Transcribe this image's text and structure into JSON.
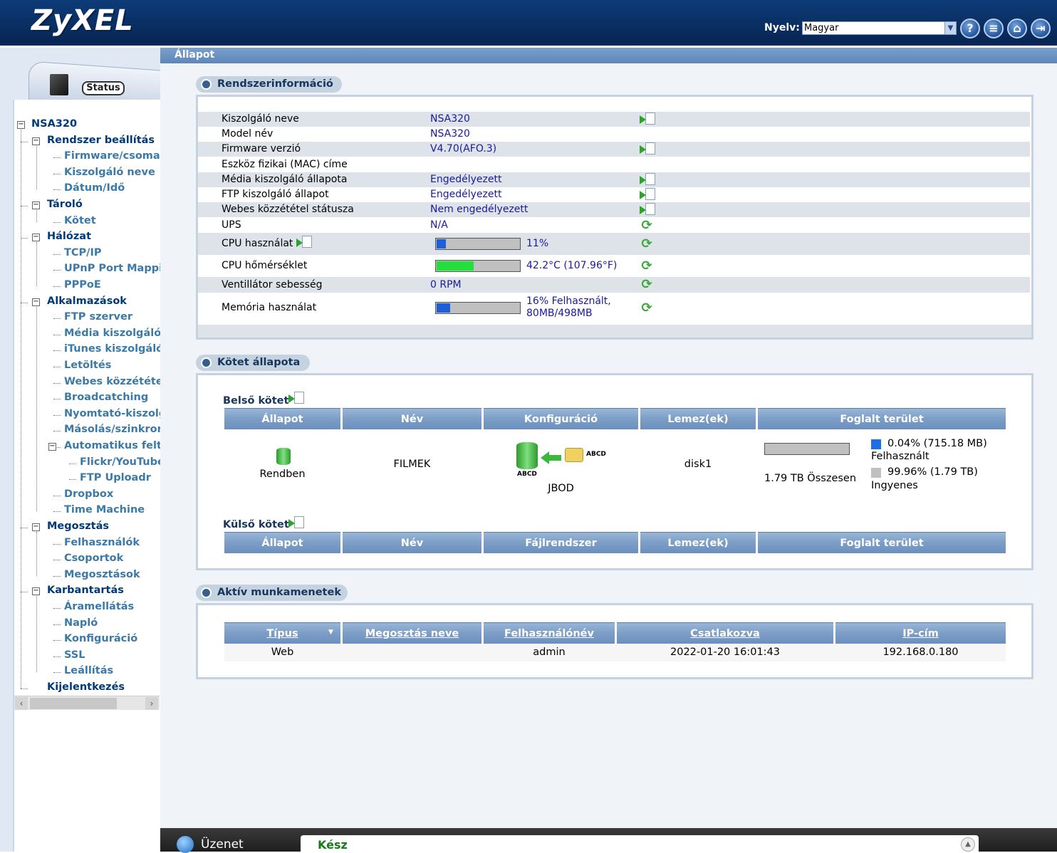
{
  "header": {
    "logo": "ZyXEL",
    "language_label": "Nyelv:",
    "language_value": "Magyar",
    "icons": [
      "help-icon",
      "about-icon",
      "home-icon",
      "logout-icon"
    ]
  },
  "sidebar": {
    "status_tab": "Status",
    "root": "NSA320",
    "tree": [
      {
        "label": "Rendszer beállítás",
        "children": [
          "Firmware/csomag",
          "Kiszolgáló neve",
          "Dátum/Idő"
        ]
      },
      {
        "label": "Tároló",
        "children": [
          "Kötet"
        ]
      },
      {
        "label": "Hálózat",
        "children": [
          "TCP/IP",
          "UPnP Port Mapping",
          "PPPoE"
        ]
      },
      {
        "label": "Alkalmazások",
        "children": [
          "FTP szerver",
          "Média kiszolgáló",
          "iTunes kiszolgáló",
          "Letöltés",
          "Webes közzététel",
          "Broadcatching",
          "Nyomtató-kiszolgáló",
          "Másolás/szinkronizálás",
          "Automatikus feltöltés",
          "Flickr/YouTube",
          "FTP Uploadr",
          "Dropbox",
          "Time Machine"
        ]
      },
      {
        "label": "Megosztás",
        "children": [
          "Felhasználók",
          "Csoportok",
          "Megosztások"
        ]
      },
      {
        "label": "Karbantartás",
        "children": [
          "Áramellátás",
          "Napló",
          "Konfiguráció",
          "SSL",
          "Leállítás"
        ]
      },
      {
        "label": "Kijelentkezés",
        "children": []
      }
    ]
  },
  "page": {
    "title": "Állapot"
  },
  "sysinfo": {
    "title": "Rendszerinformáció",
    "rows": [
      {
        "label": "Kiszolgáló neve",
        "value": "NSA320"
      },
      {
        "label": "Model név",
        "value": "NSA320"
      },
      {
        "label": "Firmware verzió",
        "value": "V4.70(AFO.3)"
      },
      {
        "label": "Eszköz fizikai (MAC) címe",
        "value": ""
      },
      {
        "label": "Média kiszolgáló állapota",
        "value": "Engedélyezett"
      },
      {
        "label": "FTP kiszolgáló állapot",
        "value": "Engedélyezett"
      },
      {
        "label": "Webes közzététel státusza",
        "value": "Nem engedélyezett"
      },
      {
        "label": "UPS",
        "value": "N/A"
      },
      {
        "label": "CPU használat",
        "value": "11%",
        "progress": 0.11
      },
      {
        "label": "CPU hőmérséklet",
        "value": "42.2°C (107.96°F)",
        "progress": 0.45
      },
      {
        "label": "Ventillátor sebesség",
        "value": "0 RPM"
      },
      {
        "label": "Memória használat",
        "value_line1": "16% Felhasznált,",
        "value_line2": "80MB/498MB",
        "progress": 0.16
      }
    ],
    "colors": {
      "cpu_bar": "#1e5fd6",
      "temp_bar": "#22e03a",
      "mem_bar": "#1e5fd6"
    }
  },
  "volume": {
    "title": "Kötet állapota",
    "internal_title": "Belső kötet",
    "external_title": "Külső kötet",
    "internal_headers": [
      "Állapot",
      "Név",
      "Konfiguráció",
      "Lemez(ek)",
      "Foglalt terület"
    ],
    "external_headers": [
      "Állapot",
      "Név",
      "Fájlrendszer",
      "Lemez(ek)",
      "Foglalt terület"
    ],
    "internal_row": {
      "status": "Rendben",
      "name": "FILMEK",
      "config": "JBOD",
      "config_icon_text": "ABCD",
      "disks": "disk1",
      "total": "1.79 TB Összesen",
      "used_pct": "0.04% (715.18 MB)",
      "used_label": "Felhasznált",
      "free_pct": "99.96% (1.79 TB)",
      "free_label": "Ingyenes",
      "used_fraction": 0.0004
    }
  },
  "sessions": {
    "title": "Aktív munkamenetek",
    "headers": [
      "Típus",
      "Megosztás neve",
      "Felhasználónév",
      "Csatlakozva",
      "IP-cím"
    ],
    "rows": [
      {
        "type": "Web",
        "share": "",
        "user": "admin",
        "connected": "2022-01-20 16:01:43",
        "ip": "192.168.0.180"
      }
    ]
  },
  "message_bar": {
    "label": "Üzenet",
    "text": "Kész"
  }
}
